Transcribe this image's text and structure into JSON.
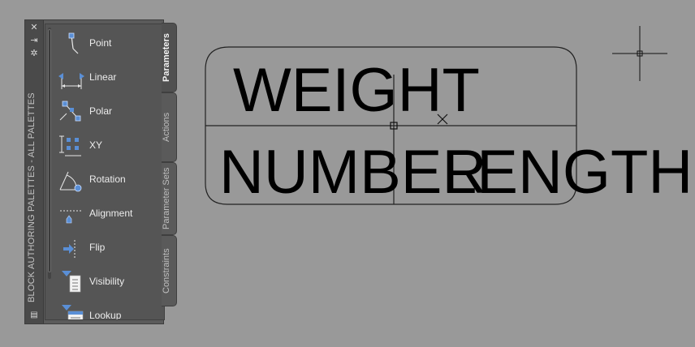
{
  "palette": {
    "title": "BLOCK AUTHORING PALETTES - ALL PALETTES",
    "buttons": [
      "close-icon",
      "autohide-icon",
      "properties-icon"
    ],
    "tools": [
      {
        "label": "Point",
        "icon": "point-parameter-icon"
      },
      {
        "label": "Linear",
        "icon": "linear-parameter-icon"
      },
      {
        "label": "Polar",
        "icon": "polar-parameter-icon"
      },
      {
        "label": "XY",
        "icon": "xy-parameter-icon"
      },
      {
        "label": "Rotation",
        "icon": "rotation-parameter-icon"
      },
      {
        "label": "Alignment",
        "icon": "alignment-parameter-icon"
      },
      {
        "label": "Flip",
        "icon": "flip-parameter-icon"
      },
      {
        "label": "Visibility",
        "icon": "visibility-parameter-icon"
      },
      {
        "label": "Lookup",
        "icon": "lookup-parameter-icon"
      }
    ],
    "tabs": [
      {
        "label": "Parameters",
        "active": true
      },
      {
        "label": "Actions",
        "active": false
      },
      {
        "label": "Parameter Sets",
        "active": false
      },
      {
        "label": "Constraints",
        "active": false
      }
    ]
  },
  "drawing": {
    "texts": [
      "WEIGHT",
      "NUMBER",
      "LENGTH"
    ]
  },
  "colors": {
    "canvas": "#999999",
    "palette_bg": "#555555",
    "grip": "#5a8fd6"
  }
}
